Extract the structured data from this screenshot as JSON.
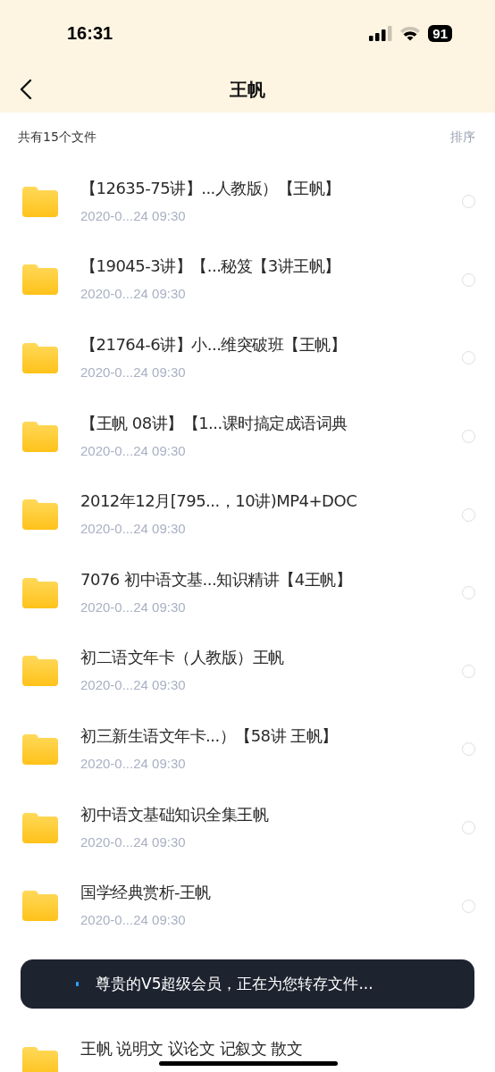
{
  "status_bar": {
    "time": "16:31",
    "battery": "91"
  },
  "nav": {
    "title": "王帆"
  },
  "summary": {
    "count": "共有15个文件",
    "sort": "排序"
  },
  "files": [
    {
      "title": "【12635-75讲】...人教版）【王帆】",
      "date": "2020-0...24 09:30",
      "selected": false
    },
    {
      "title": "【19045-3讲】【...秘笈【3讲王帆】",
      "date": "2020-0...24 09:30",
      "selected": false
    },
    {
      "title": "【21764-6讲】小...维突破班【王帆】",
      "date": "2020-0...24 09:30",
      "selected": false
    },
    {
      "title": "【王帆 08讲】【1...课时搞定成语词典",
      "date": "2020-0...24 09:30",
      "selected": false
    },
    {
      "title": "2012年12月[795...，10讲)MP4+DOC",
      "date": "2020-0...24 09:30",
      "selected": false
    },
    {
      "title": "7076 初中语文基...知识精讲【4王帆】",
      "date": "2020-0...24 09:30",
      "selected": false
    },
    {
      "title": "初二语文年卡（人教版）王帆",
      "date": "2020-0...24 09:30",
      "selected": false
    },
    {
      "title": "初三新生语文年卡...）【58讲 王帆】",
      "date": "2020-0...24 09:30",
      "selected": false
    },
    {
      "title": "初中语文基础知识全集王帆",
      "date": "2020-0...24 09:30",
      "selected": false
    },
    {
      "title": "国学经典赏析-王帆",
      "date": "2020-0...24 09:30",
      "selected": false
    },
    {
      "title": "王帆 说明文 议论文 记叙文 散文"
    }
  ],
  "toast": {
    "message": "尊贵的V5超级会员，正在为您转存文件..."
  }
}
